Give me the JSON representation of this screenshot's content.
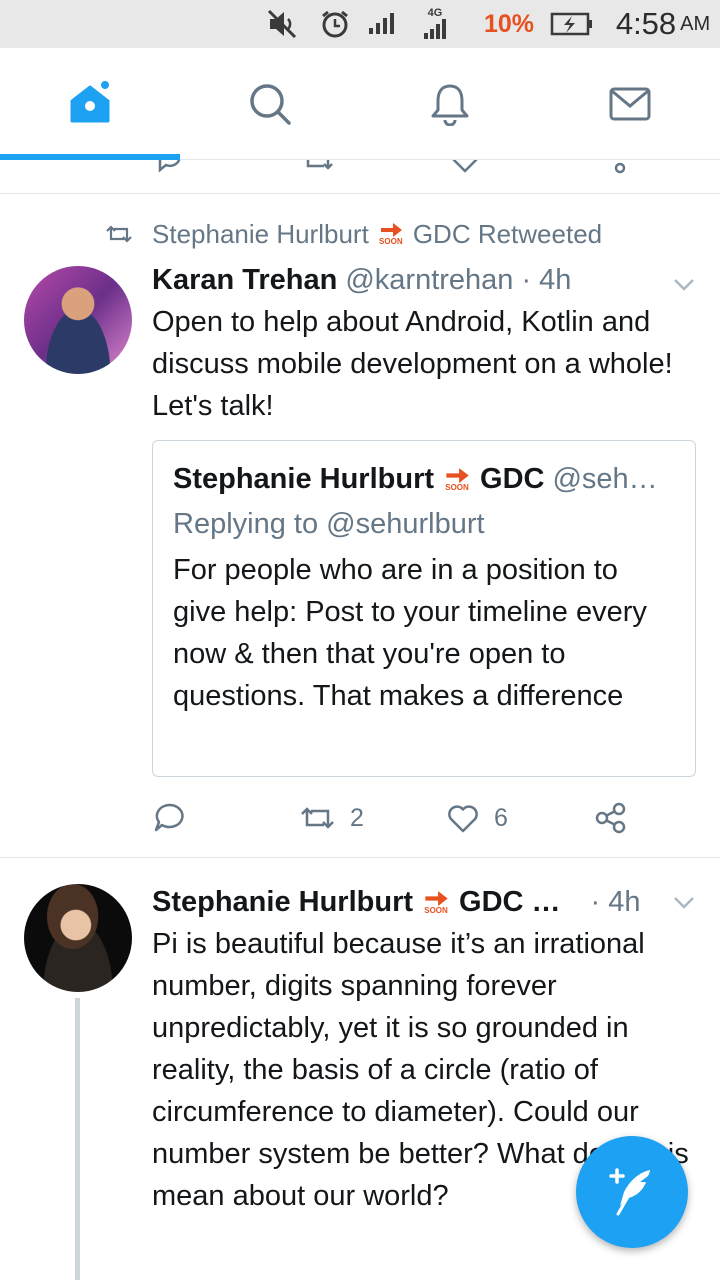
{
  "status_bar": {
    "network_label": "4G",
    "battery_percent": "10%",
    "time": "4:58",
    "ampm": "AM",
    "icons": [
      "mute-icon",
      "alarm-icon",
      "signal-icon",
      "signal-4g-icon",
      "battery-charging-icon"
    ]
  },
  "nav": {
    "tabs": [
      {
        "name": "home",
        "icon": "home-icon",
        "active": true
      },
      {
        "name": "search",
        "icon": "search-icon",
        "active": false
      },
      {
        "name": "notifications",
        "icon": "bell-icon",
        "active": false
      },
      {
        "name": "messages",
        "icon": "mail-icon",
        "active": false
      }
    ],
    "accent_color": "#1da1f2"
  },
  "tweet1": {
    "retweet_user": "Stephanie Hurlburt",
    "retweet_suffix": "GDC Retweeted",
    "author_name": "Karan Trehan",
    "author_handle": "@karntrehan",
    "time": "· 4h",
    "text": "Open to help about Android, Kotlin and discuss mobile development on a whole! Let's talk!",
    "quote": {
      "author_name": "Stephanie Hurlburt",
      "author_suffix": "GDC",
      "author_handle": "@seh…",
      "replying_to": "Replying to @sehurlburt",
      "text": "For people who are in a position to give help: Post to your timeline every now & then that you're open to questions. That makes a difference"
    },
    "retweet_count": "2",
    "like_count": "6"
  },
  "tweet2": {
    "author_name": "Stephanie Hurlburt",
    "author_suffix": "GDC …",
    "time": "· 4h",
    "text": "Pi is beautiful because it’s an irrational number, digits spanning forever unpredictably, yet it is so grounded in reality, the basis of a circle (ratio of circumference to diameter). Could our number system be better? What does this mean about our world?"
  },
  "soon_label": "SOON"
}
